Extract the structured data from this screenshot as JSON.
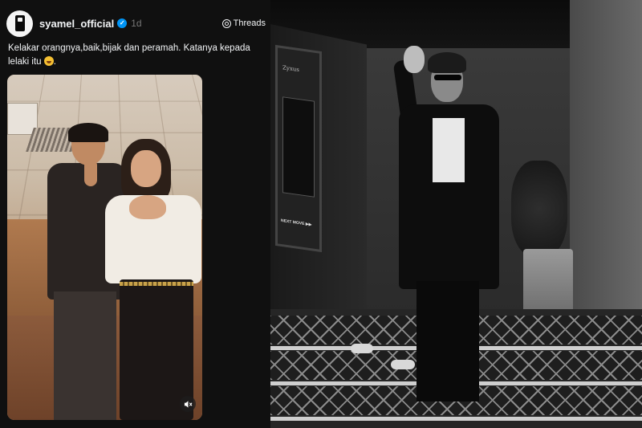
{
  "post": {
    "username": "syamel_official",
    "verified_mark": "✓",
    "timestamp": "1d",
    "platform_label": "Threads",
    "caption_line1": "Kelakar orangnya,baik,bijak dan peramah. Katanya kepada",
    "caption_line2": "lelaki itu",
    "caption_end": ".",
    "emoji": "face-with-tears-of-joy-icon",
    "mute_icon": "muted-speaker-icon"
  },
  "photo": {
    "poster_title": "Zyxus",
    "poster_sign": "NEXT MOVE ▶▶"
  },
  "colors": {
    "panel_bg": "#101010",
    "text": "#f3f5f7",
    "muted_text": "#777777",
    "verified_blue": "#0095f6"
  }
}
